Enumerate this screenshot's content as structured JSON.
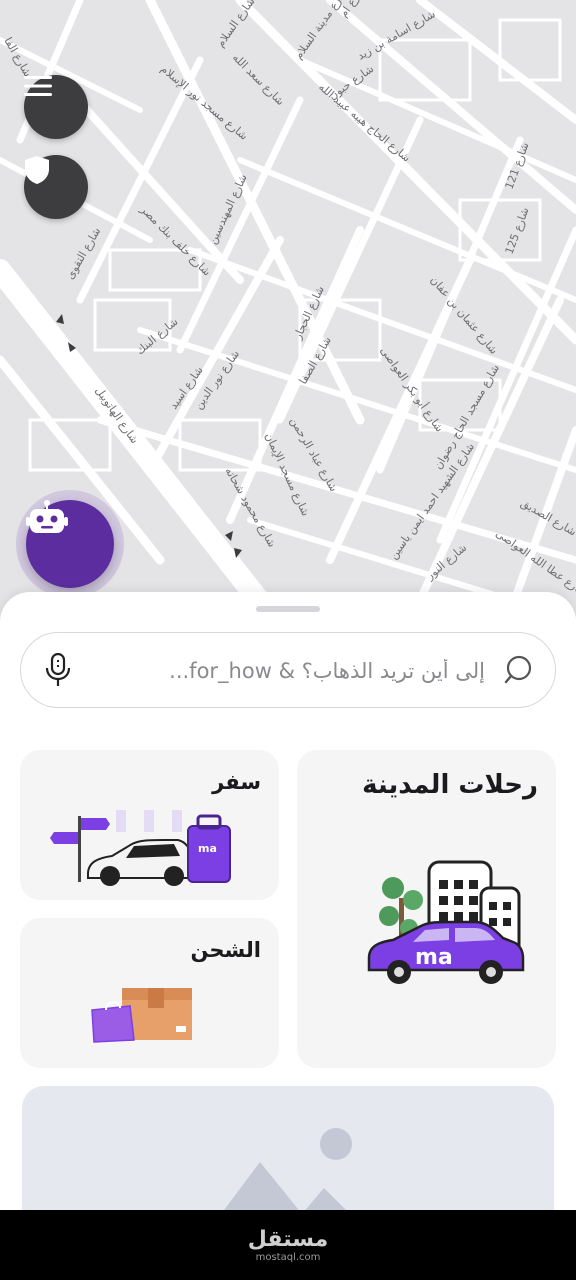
{
  "map": {
    "street_labels": [
      "شارع الفا",
      "شارع السلام",
      "شارع مدينة السلام",
      "شارع ام",
      "شارع اسامة بن زيد",
      "شارع حبون",
      "شارع الحاج هيبه عبيد الله",
      "شارع سعد الله",
      "شارع مسجد نور الإسلام",
      "شارع 121",
      "شارع 125",
      "شارع المهندسين",
      "شارع خلف بنك مصر",
      "شارع التقوى",
      "شارع الحجار",
      "شارع عثمان بن عفان",
      "شارع البنك",
      "شارع الصفا",
      "شارع أبو بكر العواصى",
      "شارع نور الدين",
      "شارع اسيد",
      "شارع الهاتوبيل",
      "شارع عباد الرحمن",
      "شارع مسجد الحاج رضوان",
      "شارع مسجد الإيمان",
      "شارع محمود شحاته",
      "شارع الشهيد احمد ايمن ياسين",
      "شارع الصديق",
      "شارع عطا الله العواصى",
      "شارع النور"
    ]
  },
  "icons": {
    "menu": "hamburger-menu-icon",
    "shield": "shield-icon",
    "assistant": "robot-icon",
    "search": "search-icon",
    "mic": "microphone-icon"
  },
  "search": {
    "placeholder": "إلى أين تريد الذهاب؟ & for_how..."
  },
  "services": {
    "city": {
      "label": "رحلات المدينة"
    },
    "travel": {
      "label": "سفر"
    },
    "shipping": {
      "label": "الشحن"
    }
  },
  "brand": {
    "logo_text": "ma"
  },
  "watermark": {
    "brand": "مستقل",
    "url": "mostaql.com"
  },
  "colors": {
    "primary_purple": "#7b3fe4",
    "dark_purple": "#5b2d9e",
    "map_background": "#e4e4e6",
    "map_roads": "#ffffff",
    "button_dark": "#3d3d3f",
    "card_background": "#f5f5f6"
  }
}
